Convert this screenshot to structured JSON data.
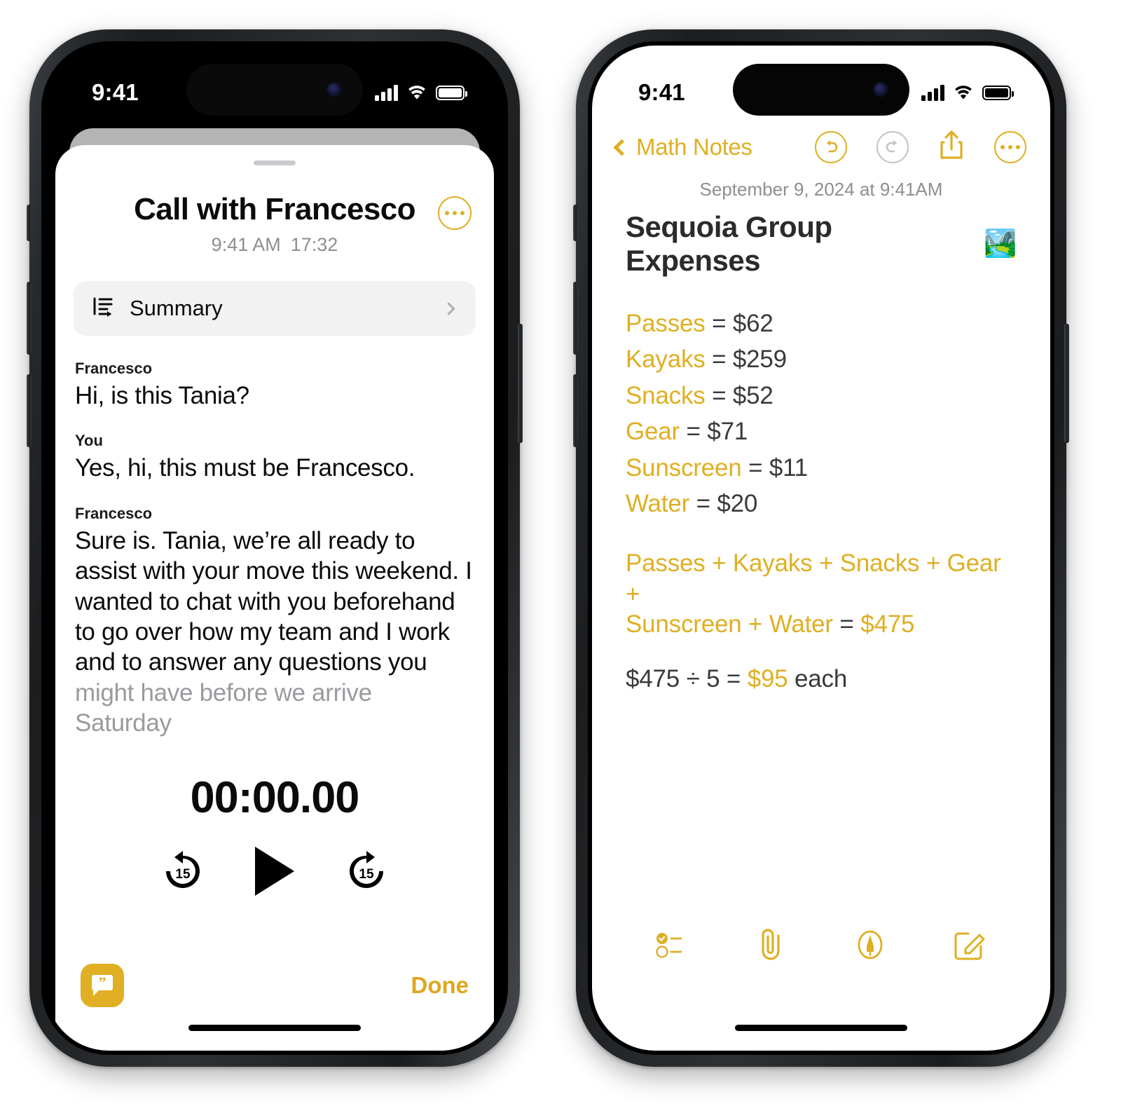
{
  "accent": "#DFAF23",
  "left_phone": {
    "status_bar": {
      "time": "9:41",
      "signal": "cellular-bars-icon",
      "wifi": "wifi-icon",
      "battery": "battery-icon"
    },
    "sheet": {
      "title": "Call with Francesco",
      "time": "9:41 AM",
      "duration": "17:32",
      "more_button": "more-options-icon",
      "summary_row": {
        "icon": "summary-lines-icon",
        "label": "Summary",
        "chevron": "chevron-right-icon"
      },
      "transcript": [
        {
          "speaker": "Francesco",
          "text": "Hi, is this Tania?"
        },
        {
          "speaker": "You",
          "text": "Yes, hi, this must be Francesco."
        },
        {
          "speaker": "Francesco",
          "text": "Sure is. Tania, we’re all ready to assist with your move this weekend. I wanted to chat with you beforehand to go over how my team and I work and to answer any questions you",
          "faded_text": "might have before we arrive Saturday"
        }
      ],
      "player": {
        "timer": "00:00.00",
        "skip_back_label": "15",
        "skip_forward_label": "15",
        "play_button": "play-icon"
      },
      "bottom_bar": {
        "quote_button": "quote-bubble-icon",
        "done_label": "Done"
      }
    }
  },
  "right_phone": {
    "status_bar": {
      "time": "9:41",
      "signal": "cellular-bars-icon",
      "wifi": "wifi-icon",
      "battery": "battery-icon"
    },
    "nav": {
      "back_label": "Math Notes",
      "back_chevron": "chevron-left-icon",
      "undo": "undo-icon",
      "redo": "redo-icon",
      "share": "share-icon",
      "more": "more-options-icon"
    },
    "note": {
      "date": "September 9, 2024 at 9:41AM",
      "title": "Sequoia Group Expenses",
      "title_emoji": "🏞️",
      "expenses": [
        {
          "name": "Passes",
          "eq": "=",
          "value": "$62"
        },
        {
          "name": "Kayaks",
          "eq": "=",
          "value": "$259"
        },
        {
          "name": "Snacks",
          "eq": "=",
          "value": "$52"
        },
        {
          "name": "Gear",
          "eq": "=",
          "value": "$71"
        },
        {
          "name": "Sunscreen",
          "eq": "=",
          "value": "$11"
        },
        {
          "name": "Water",
          "eq": "=",
          "value": "$20"
        }
      ],
      "sum_expression_line1": "Passes + Kayaks + Snacks + Gear +",
      "sum_expression_line2_vars": "Sunscreen + Water",
      "sum_equals": "=",
      "sum_total": "$475",
      "division_prefix": "$475 ÷ 5 =",
      "division_result": "$95",
      "division_suffix": "each"
    },
    "toolbar": {
      "checklist": "checklist-icon",
      "attachment": "paperclip-icon",
      "markup": "markup-pen-icon",
      "compose": "compose-icon"
    }
  }
}
